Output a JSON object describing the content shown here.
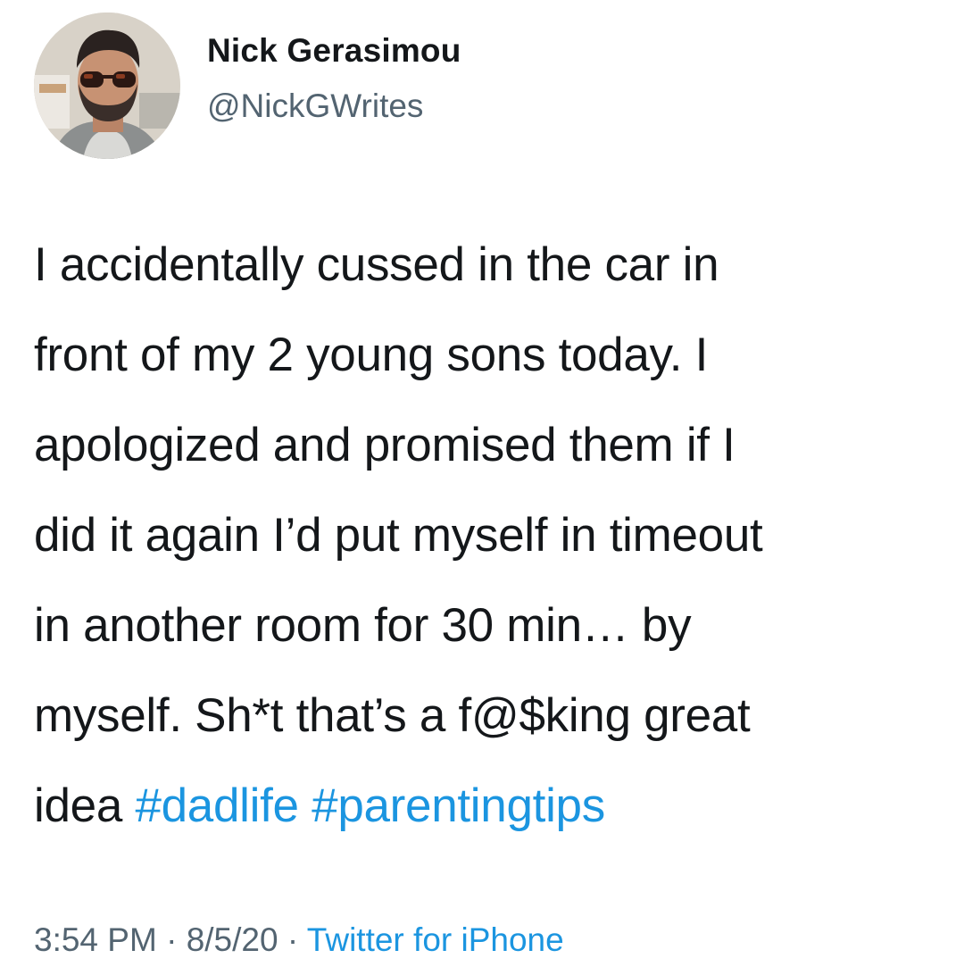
{
  "author": {
    "name": "Nick Gerasimou",
    "handle": "@NickGWrites"
  },
  "tweet": {
    "lines": [
      "I accidentally cussed in the car in",
      "front of my 2 young sons today. I",
      "apologized and promised them if I",
      "did it again I’d put myself in timeout",
      "in another room for 30 min… by",
      "myself. Sh*t that’s a f@$king great",
      "idea"
    ],
    "hashtags": [
      "#dadlife",
      "#parentingtips"
    ]
  },
  "meta": {
    "time": "3:54 PM",
    "separator": "·",
    "date": "8/5/20",
    "source": "Twitter for iPhone"
  },
  "colors": {
    "text": "#14171a",
    "secondary": "#536471",
    "link": "#1b95e0"
  }
}
